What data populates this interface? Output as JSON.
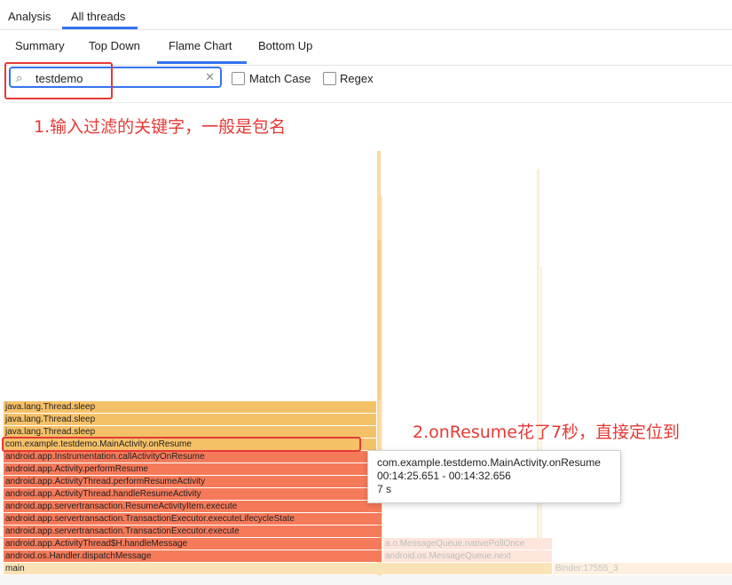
{
  "top_tabs": [
    {
      "label": "Analysis",
      "active": false
    },
    {
      "label": "All threads",
      "active": true
    }
  ],
  "sub_tabs": [
    {
      "label": "Summary",
      "active": false
    },
    {
      "label": "Top Down",
      "active": false
    },
    {
      "label": "Flame Chart",
      "active": true
    },
    {
      "label": "Bottom Up",
      "active": false
    }
  ],
  "search": {
    "value": "testdemo",
    "match_case_label": "Match Case",
    "regex_label": "Regex",
    "match_case_checked": false,
    "regex_checked": false
  },
  "annotations": {
    "filter_note": "1.输入过滤的关键字，一般是包名",
    "resume_note": "2.onResume花了7秒，直接定位到"
  },
  "flame": {
    "frames": [
      {
        "label": "java.lang.Thread.sleep",
        "color": "yellow"
      },
      {
        "label": "java.lang.Thread.sleep",
        "color": "yellow"
      },
      {
        "label": "java.lang.Thread.sleep",
        "color": "yellow"
      },
      {
        "label": "com.example.testdemo.MainActivity.onResume",
        "color": "yellow"
      },
      {
        "label": "android.app.Instrumentation.callActivityOnResume",
        "color": "red"
      },
      {
        "label": "android.app.Activity.performResume",
        "color": "red"
      },
      {
        "label": "android.app.ActivityThread.performResumeActivity",
        "color": "red"
      },
      {
        "label": "android.app.ActivityThread.handleResumeActivity",
        "color": "red"
      },
      {
        "label": "android.app.servertransaction.ResumeActivityItem.execute",
        "color": "red"
      },
      {
        "label": "android.app.servertransaction.TransactionExecutor.executeLifecycleState",
        "color": "red"
      },
      {
        "label": "android.app.servertransaction.TransactionExecutor.execute",
        "color": "red"
      },
      {
        "label": "android.app.ActivityThread$H.handleMessage",
        "color": "red"
      },
      {
        "label": "android.os.Handler.dispatchMessage",
        "color": "red"
      },
      {
        "label": "main",
        "color": "main"
      }
    ],
    "side_frames": [
      {
        "label": "a.o.MessageQueue.nativePollOnce"
      },
      {
        "label": "android.os.MessageQueue.next"
      },
      {
        "label": "Binder:17555_3"
      }
    ]
  },
  "tooltip": {
    "method": "com.example.testdemo.MainActivity.onResume",
    "range": "00:14:25.651 - 00:14:32.656",
    "duration": "7 s"
  },
  "colors": {
    "accent": "#3574f0",
    "highlight": "#e53935",
    "frame_yellow": "#f5c168",
    "frame_red": "#f57a5a"
  }
}
